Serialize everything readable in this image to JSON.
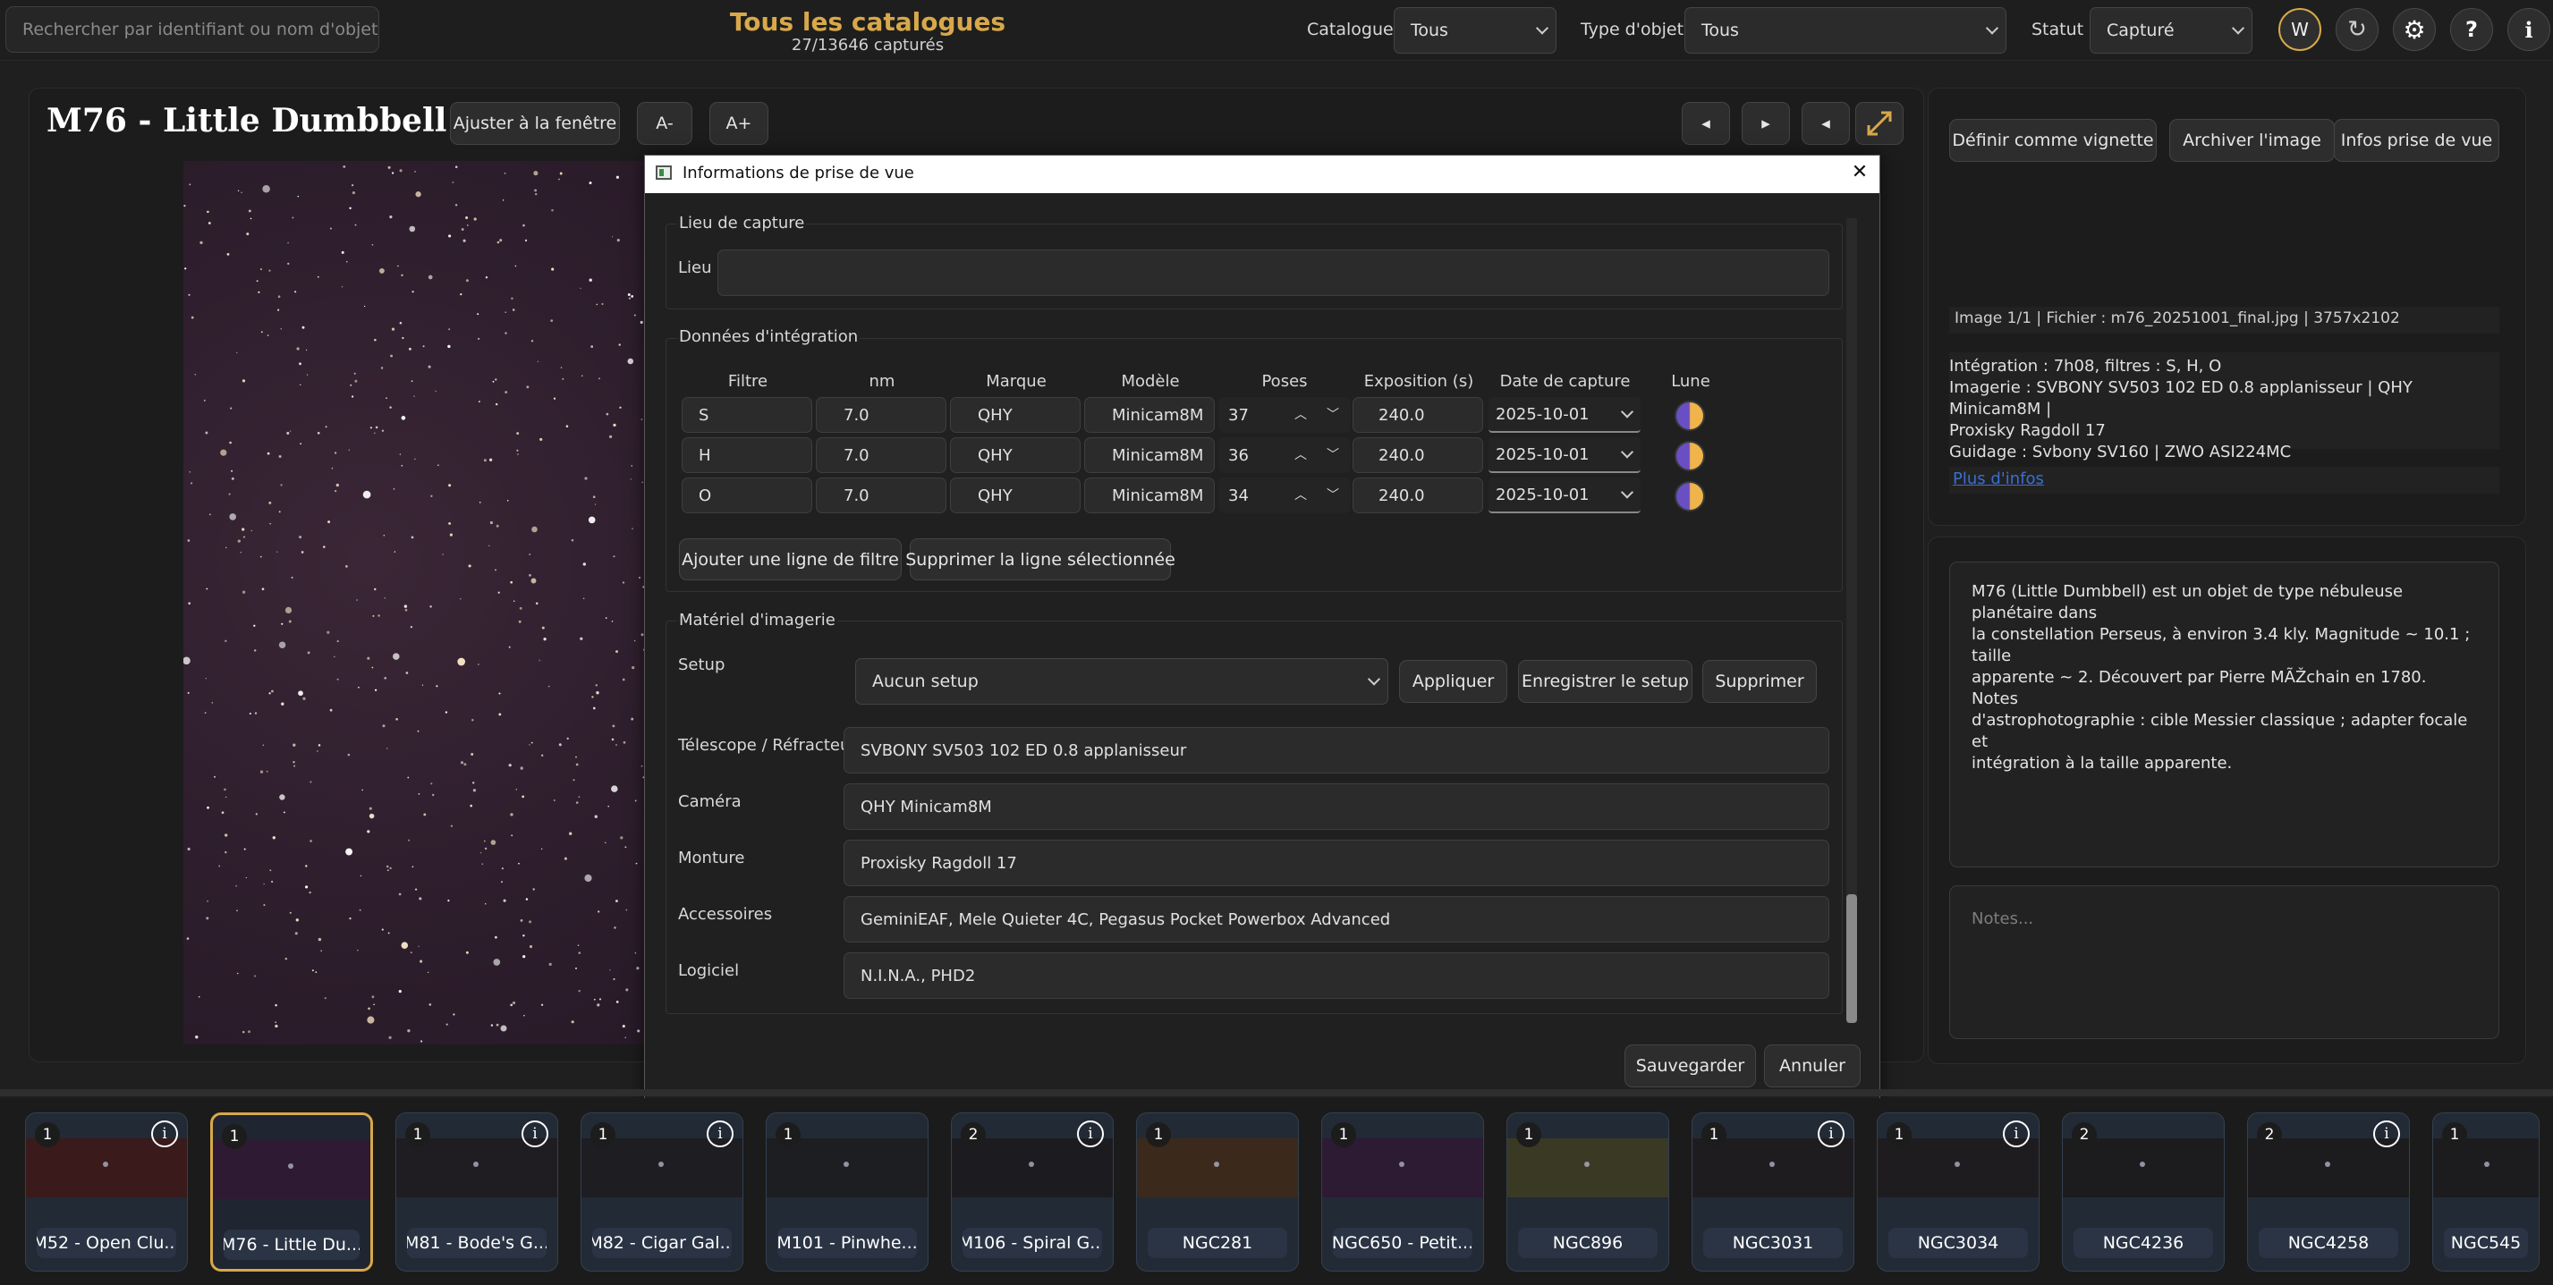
{
  "header": {
    "search_placeholder": "Rechercher par identifiant ou nom d'objet",
    "title": "Tous les catalogues",
    "subtitle": "27/13646 capturés",
    "catalog_label": "Catalogue",
    "catalog_value": "Tous",
    "type_label": "Type d'objet",
    "type_value": "Tous",
    "status_label": "Statut",
    "status_value": "Capturé",
    "user_initial": "W",
    "refresh_icon": "↻",
    "settings_icon": "⚙",
    "help_icon": "?",
    "info_icon": "i"
  },
  "viewer": {
    "title": "M76 - Little Dumbbell",
    "fit_button": "Ajuster à la fenêtre",
    "zoom_out": "A-",
    "zoom_in": "A+",
    "prev_icon": "◂",
    "next_icon": "▸",
    "collapse_icon": "◂"
  },
  "right_panel": {
    "set_thumbnail": "Définir comme vignette",
    "archive": "Archiver l'image",
    "capture_info": "Infos prise de vue",
    "file_info": "Image 1/1 | Fichier : m76_20251001_final.jpg | 3757x2102",
    "integration_line": "Intégration : 7h08, filtres : S, H, O",
    "imaging_line": "Imagerie : SVBONY SV503 102 ED  0.8 applanisseur | QHY Minicam8M |",
    "imaging_line2": "Proxisky Ragdoll 17",
    "guiding_line": "Guidage : Svbony SV160 | ZWO ASI224MC",
    "more_info": "Plus d'infos",
    "description_1": "M76 (Little Dumbbell) est un objet de type nébuleuse planétaire dans",
    "description_2": "la constellation Perseus, à environ 3.4 kly. Magnitude ~ 10.1 ; taille",
    "description_3": "apparente ~ 2. Découvert par Pierre MÃŽchain en 1780. Notes",
    "description_4": "d'astrophotographie : cible Messier classique ; adapter focale et",
    "description_5": "intégration à la taille apparente.",
    "notes_placeholder": "Notes..."
  },
  "dialog": {
    "title": "Informations de prise de vue",
    "close_icon": "✕",
    "location_section": "Lieu de capture",
    "location_label": "Lieu",
    "location_value": "",
    "integration_section": "Données d'intégration",
    "columns": {
      "filter": "Filtre",
      "nm": "nm",
      "brand": "Marque",
      "model": "Modèle",
      "poses": "Poses",
      "exposure": "Exposition (s)",
      "date": "Date de capture",
      "moon": "Lune"
    },
    "rows": [
      {
        "filter": "S",
        "nm": "7.0",
        "brand": "QHY",
        "model": "Minicam8M",
        "poses": "37",
        "exposure": "240.0",
        "date": "2025-10-01"
      },
      {
        "filter": "H",
        "nm": "7.0",
        "brand": "QHY",
        "model": "Minicam8M",
        "poses": "36",
        "exposure": "240.0",
        "date": "2025-10-01"
      },
      {
        "filter": "O",
        "nm": "7.0",
        "brand": "QHY",
        "model": "Minicam8M",
        "poses": "34",
        "exposure": "240.0",
        "date": "2025-10-01"
      }
    ],
    "add_filter": "Ajouter une ligne de filtre",
    "delete_row": "Supprimer la ligne sélectionnée",
    "equipment_section": "Matériel d'imagerie",
    "setup_label": "Setup",
    "setup_value": "Aucun setup",
    "apply": "Appliquer",
    "save_setup": "Enregistrer le setup",
    "delete": "Supprimer",
    "telescope_label": "Télescope / Réfracteur",
    "telescope_value": "SVBONY SV503 102 ED  0.8 applanisseur",
    "camera_label": "Caméra",
    "camera_value": "QHY Minicam8M",
    "mount_label": "Monture",
    "mount_value": "Proxisky Ragdoll 17",
    "accessories_label": "Accessoires",
    "accessories_value": "GeminiEAF, Mele Quieter 4C, Pegasus Pocket Powerbox Advanced",
    "software_label": "Logiciel",
    "software_value": "N.I.N.A., PHD2",
    "save": "Sauvegarder",
    "cancel": "Annuler"
  },
  "filmstrip": [
    {
      "count": "1",
      "name": "M52 - Open Clu...",
      "info": true,
      "color": "#3a1a1a"
    },
    {
      "count": "1",
      "name": "M76 - Little Du...",
      "info": false,
      "color": "#2e1a33"
    },
    {
      "count": "1",
      "name": "M81 - Bode's G...",
      "info": true,
      "color": "#1f1d22"
    },
    {
      "count": "1",
      "name": "M82 - Cigar Gal...",
      "info": true,
      "color": "#1e1d22"
    },
    {
      "count": "1",
      "name": "M101 - Pinwhe...",
      "info": false,
      "color": "#1d1e22"
    },
    {
      "count": "2",
      "name": "M106 - Spiral G...",
      "info": true,
      "color": "#1c1c20"
    },
    {
      "count": "1",
      "name": "NGC281",
      "info": false,
      "color": "#3b2a1c"
    },
    {
      "count": "1",
      "name": "NGC650 - Petit...",
      "info": false,
      "color": "#2d1a33"
    },
    {
      "count": "1",
      "name": "NGC896",
      "info": false,
      "color": "#3a3a24"
    },
    {
      "count": "1",
      "name": "NGC3031",
      "info": true,
      "color": "#1f1c20"
    },
    {
      "count": "1",
      "name": "NGC3034",
      "info": true,
      "color": "#1f1c20"
    },
    {
      "count": "2",
      "name": "NGC4236",
      "info": false,
      "color": "#1c1c1e"
    },
    {
      "count": "2",
      "name": "NGC4258",
      "info": true,
      "color": "#1c1c1e"
    },
    {
      "count": "1",
      "name": "NGC545",
      "info": false,
      "color": "#1c1c1e"
    }
  ],
  "colors": {
    "accent": "#d8a84a",
    "background": "#1f1f1f",
    "moon": "#8e6bd6"
  }
}
